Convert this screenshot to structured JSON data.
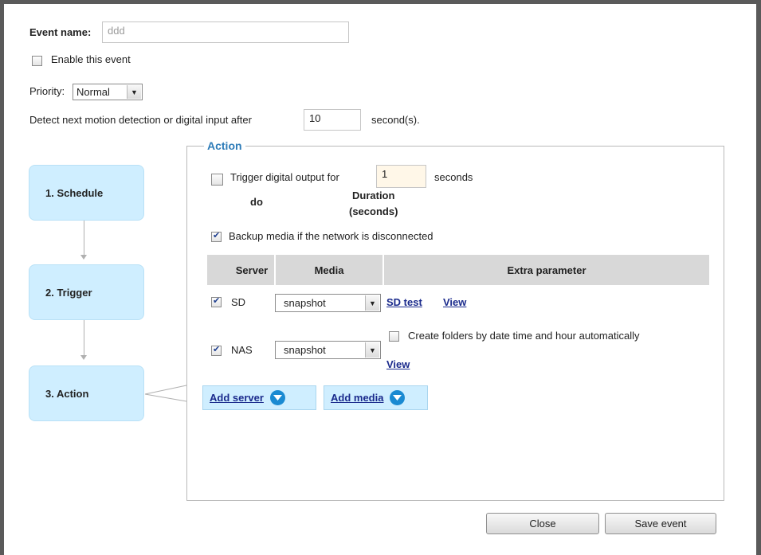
{
  "event": {
    "name_label": "Event name:",
    "name_value": "ddd",
    "enable_label": "Enable this event",
    "enable_checked": false,
    "priority_label": "Priority:",
    "priority_value": "Normal",
    "detect_label": "Detect next motion detection or digital input after",
    "detect_value": "10",
    "detect_unit": "second(s)."
  },
  "steps": [
    {
      "label": "1. Schedule"
    },
    {
      "label": "2. Trigger"
    },
    {
      "label": "3. Action"
    }
  ],
  "action": {
    "legend": "Action",
    "trigger_label": "Trigger digital output for",
    "trigger_value": "1",
    "trigger_unit": "seconds",
    "trigger_checked": false,
    "col_do": "do",
    "col_duration_line1": "Duration",
    "col_duration_line2": "(seconds)",
    "backup_label": "Backup media if the network is disconnected",
    "backup_checked": true,
    "table_headers": [
      "Server",
      "Media",
      "Extra parameter"
    ],
    "rows": [
      {
        "server": "SD",
        "checked": true,
        "media": "snapshot",
        "link1": "SD test",
        "link2": "View"
      },
      {
        "server": "NAS",
        "checked": true,
        "media": "snapshot",
        "folder_label": "Create folders by date time and hour automatically",
        "folder_checked": false,
        "link": "View"
      }
    ],
    "add_server": "Add server",
    "add_media": "Add media"
  },
  "buttons": {
    "close": "Close",
    "save": "Save event"
  },
  "icons": {
    "dropdown": "chevron-down-icon",
    "add": "circle-chevron-down-icon"
  },
  "colors": {
    "accent": "#2e7cb8",
    "step_bg": "#cfeeff",
    "link": "#1a2a8c",
    "add_icon": "#1a8ad2"
  }
}
